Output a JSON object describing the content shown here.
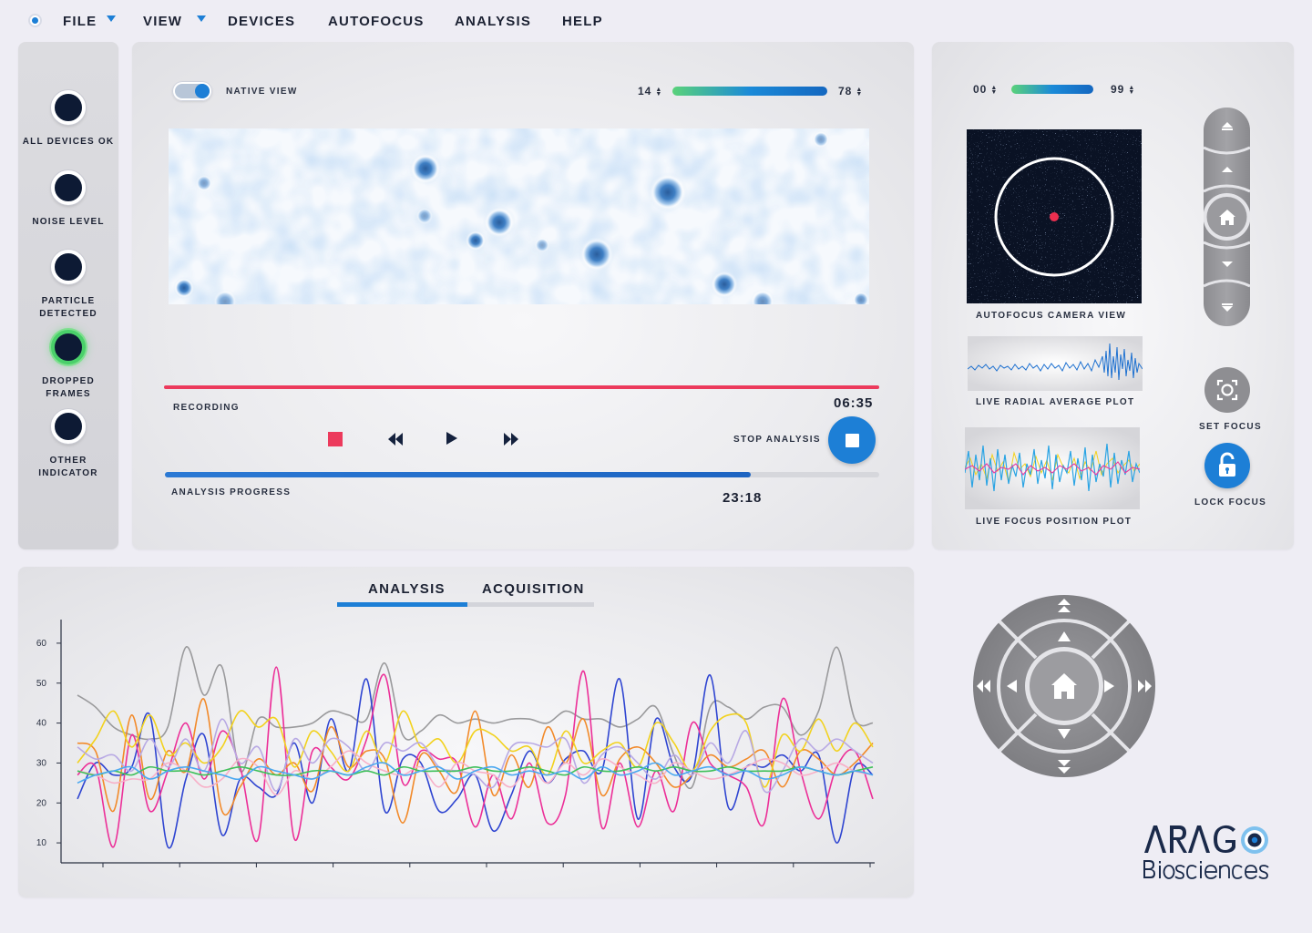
{
  "menu": {
    "items": [
      {
        "label": "FILE",
        "has_caret": true
      },
      {
        "label": "VIEW",
        "has_caret": true
      },
      {
        "label": "DEVICES",
        "has_caret": false
      },
      {
        "label": "AUTOFOCUS",
        "has_caret": false
      },
      {
        "label": "ANALYSIS",
        "has_caret": false
      },
      {
        "label": "HELP",
        "has_caret": false
      }
    ]
  },
  "indicators": [
    {
      "label": "ALL DEVICES OK",
      "state": "off"
    },
    {
      "label": "NOISE LEVEL",
      "state": "off"
    },
    {
      "label": "PARTICLE DETECTED",
      "state": "off"
    },
    {
      "label": "DROPPED FRAMES",
      "state": "active"
    },
    {
      "label": "OTHER INDICATOR",
      "state": "off"
    }
  ],
  "main": {
    "native_view_label": "NATIVE VIEW",
    "native_view_on": true,
    "range_min": "14",
    "range_max": "78",
    "recording_label": "RECORDING",
    "recording_time": "06:35",
    "stop_analysis_label": "STOP ANALYSIS",
    "analysis_progress_label": "ANALYSIS PROGRESS",
    "analysis_time": "23:18",
    "analysis_progress": 0.82
  },
  "autofocus": {
    "range_min": "00",
    "range_max": "99",
    "camera_label": "AUTOFOCUS CAMERA VIEW",
    "radial_label": "LIVE RADIAL AVERAGE PLOT",
    "position_label": "LIVE FOCUS POSITION PLOT",
    "set_focus_label": "SET FOCUS",
    "lock_focus_label": "LOCK FOCUS"
  },
  "chart_tabs": {
    "analysis": "ANALYSIS",
    "acquisition": "ACQUISITION",
    "active": "analysis"
  },
  "chart_data": {
    "type": "line",
    "title": "",
    "xlabel": "",
    "ylabel": "",
    "ylim": [
      5,
      65
    ],
    "y_ticks": [
      10,
      20,
      30,
      40,
      50,
      60
    ],
    "grid": false,
    "legend": "none",
    "x": [
      0,
      20,
      40,
      60,
      80,
      100,
      120,
      140,
      160,
      180,
      200,
      220,
      240,
      260,
      280,
      300,
      320,
      340,
      360,
      380,
      400,
      420,
      440,
      460,
      480,
      500,
      520,
      540,
      560,
      580,
      600,
      620,
      640,
      660,
      680,
      700,
      720,
      740,
      760,
      780,
      800,
      820,
      840,
      860,
      880
    ],
    "series": [
      {
        "color": "#9a9a9c",
        "values": [
          47,
          44,
          39,
          37,
          36,
          39,
          59,
          47,
          54,
          28,
          41,
          39,
          39,
          40,
          43,
          42,
          41,
          55,
          37,
          38,
          42,
          40,
          41,
          40,
          41,
          41,
          40,
          43,
          41,
          41,
          39,
          41,
          44,
          32,
          24,
          44,
          44,
          41,
          44,
          44,
          37,
          43,
          59,
          41,
          40
        ]
      },
      {
        "color": "#2f45d1",
        "values": [
          21,
          30,
          27,
          29,
          42,
          9,
          26,
          37,
          12,
          26,
          24,
          22,
          35,
          20,
          41,
          28,
          51,
          18,
          31,
          30,
          18,
          21,
          27,
          13,
          22,
          33,
          25,
          31,
          33,
          28,
          51,
          16,
          41,
          29,
          27,
          52,
          19,
          29,
          29,
          32,
          28,
          32,
          10,
          29,
          27
        ]
      },
      {
        "color": "#ec2f98",
        "values": [
          27,
          29,
          9,
          37,
          18,
          28,
          40,
          26,
          38,
          29,
          11,
          54,
          11,
          33,
          29,
          26,
          36,
          52,
          25,
          33,
          31,
          30,
          14,
          27,
          16,
          30,
          15,
          22,
          53,
          14,
          30,
          14,
          28,
          18,
          40,
          30,
          27,
          24,
          15,
          46,
          28,
          16,
          29,
          33,
          21
        ]
      },
      {
        "color": "#f28a2a",
        "values": [
          35,
          33,
          18,
          42,
          21,
          33,
          28,
          46,
          18,
          24,
          31,
          27,
          30,
          23,
          39,
          29,
          33,
          31,
          15,
          32,
          28,
          23,
          43,
          22,
          32,
          24,
          39,
          30,
          41,
          22,
          31,
          34,
          30,
          24,
          27,
          32,
          29,
          31,
          33,
          24,
          33,
          31,
          27,
          30,
          35
        ]
      },
      {
        "color": "#f2d21e",
        "values": [
          30,
          36,
          43,
          34,
          42,
          32,
          35,
          30,
          34,
          43,
          39,
          41,
          29,
          38,
          33,
          28,
          38,
          30,
          43,
          34,
          36,
          30,
          38,
          37,
          33,
          34,
          27,
          38,
          30,
          33,
          35,
          29,
          40,
          35,
          28,
          38,
          42,
          40,
          24,
          37,
          33,
          41,
          33,
          40,
          34
        ]
      },
      {
        "color": "#b8a9e4",
        "values": [
          34,
          31,
          32,
          28,
          36,
          29,
          36,
          28,
          41,
          30,
          34,
          23,
          36,
          30,
          36,
          34,
          28,
          35,
          33,
          35,
          29,
          28,
          27,
          24,
          34,
          35,
          34,
          36,
          25,
          32,
          34,
          30,
          26,
          32,
          27,
          35,
          30,
          38,
          23,
          28,
          36,
          33,
          36,
          33,
          30
        ]
      },
      {
        "color": "#f7b0c8",
        "values": [
          28,
          27,
          25,
          26,
          26,
          30,
          28,
          24,
          26,
          31,
          29,
          22,
          28,
          26,
          29,
          33,
          30,
          28,
          27,
          29,
          24,
          30,
          28,
          27,
          24,
          29,
          25,
          30,
          27,
          31,
          29,
          27,
          25,
          30,
          28,
          26,
          27,
          29,
          31,
          30,
          27,
          28,
          30,
          28,
          27
        ]
      },
      {
        "color": "#3fc05a",
        "values": [
          28,
          27,
          28,
          27,
          29,
          28,
          28,
          27,
          28,
          29,
          28,
          27,
          27,
          28,
          28,
          27,
          28,
          27,
          29,
          28,
          28,
          28,
          29,
          28,
          28,
          29,
          28,
          27,
          29,
          28,
          28,
          29,
          28,
          29,
          28,
          28,
          29,
          28,
          28,
          28,
          29,
          28,
          27,
          28,
          29
        ]
      },
      {
        "color": "#4aa8f0",
        "values": [
          25,
          27,
          28,
          29,
          26,
          28,
          29,
          28,
          27,
          26,
          29,
          28,
          27,
          26,
          28,
          27,
          29,
          30,
          27,
          28,
          29,
          26,
          28,
          29,
          27,
          28,
          27,
          28,
          26,
          29,
          27,
          28,
          30,
          27,
          28,
          29,
          27,
          28,
          26,
          27,
          29,
          28,
          27,
          28,
          27
        ]
      }
    ]
  }
}
